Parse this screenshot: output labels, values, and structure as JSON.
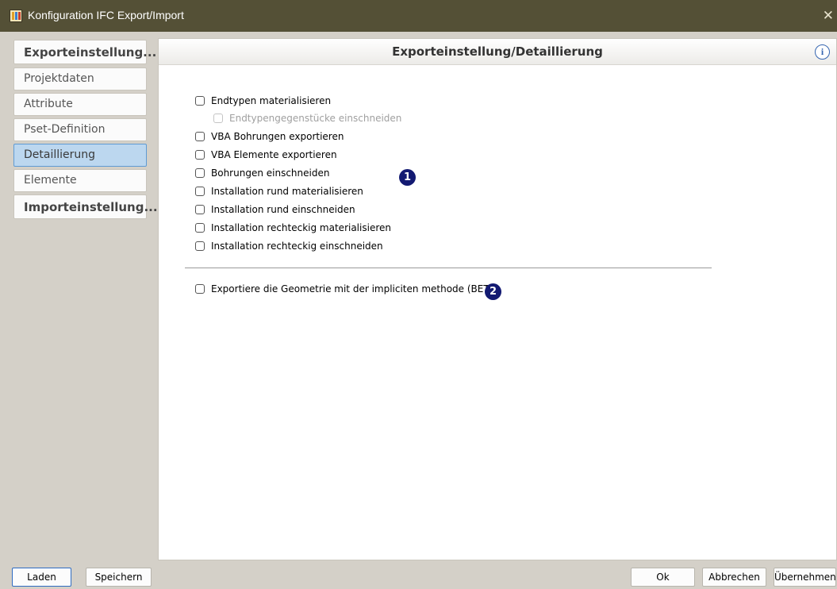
{
  "window": {
    "title": "Konfiguration IFC Export/Import",
    "close_glyph": "✕",
    "icon": "app-logo-icon",
    "icon_colors": [
      "#e0a028",
      "#3b7fd1",
      "#c84030"
    ]
  },
  "sidebar": {
    "items": [
      {
        "label": "Exporteinstellung...",
        "style": "group-header",
        "selected": false
      },
      {
        "label": "Projektdaten",
        "selected": false
      },
      {
        "label": "Attribute",
        "selected": false
      },
      {
        "label": "Pset-Definition",
        "selected": false
      },
      {
        "label": "Detaillierung",
        "selected": true
      },
      {
        "label": "Elemente",
        "selected": false
      },
      {
        "label": "Importeinstellung...",
        "style": "group-header",
        "selected": false
      }
    ],
    "selected_color": "#bcd7ef"
  },
  "panel": {
    "title": "Exporteinstellung/Detaillierung",
    "info_icon": "info-icon",
    "options": [
      {
        "label": "Endtypen materialisieren",
        "checked": false,
        "enabled": true
      },
      {
        "label": "Endtypengegenstücke einschneiden",
        "checked": false,
        "enabled": false
      },
      {
        "label": "VBA Bohrungen exportieren",
        "checked": false,
        "enabled": true
      },
      {
        "label": "VBA Elemente exportieren",
        "checked": false,
        "enabled": true
      },
      {
        "label": "Bohrungen einschneiden",
        "checked": false,
        "enabled": true
      },
      {
        "label": "Installation rund materialisieren",
        "checked": false,
        "enabled": true
      },
      {
        "label": "Installation rund einschneiden",
        "checked": false,
        "enabled": true
      },
      {
        "label": "Installation rechteckig materialisieren",
        "checked": false,
        "enabled": true
      },
      {
        "label": "Installation rechteckig einschneiden",
        "checked": false,
        "enabled": true
      }
    ],
    "geometry_option": {
      "label": "Exportiere die Geometrie mit der impliciten methode (BETA)",
      "checked": false,
      "enabled": true
    },
    "badges": [
      "1",
      "2"
    ],
    "badge_color": "#131a72"
  },
  "footer": {
    "load": "Laden",
    "save": "Speichern",
    "ok": "Ok",
    "cancel": "Abbrechen",
    "apply": "Übernehmen"
  }
}
